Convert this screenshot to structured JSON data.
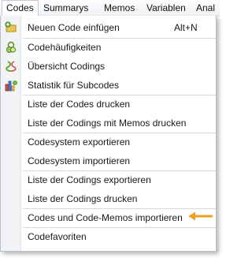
{
  "menubar": {
    "items": [
      "Codes",
      "Summarys",
      "Memos",
      "Variablen",
      "Anal"
    ]
  },
  "menu": {
    "items": [
      {
        "label": "Neuen Code einfügen",
        "shortcut": "Alt+N",
        "icon": "new-code-icon"
      },
      {
        "label": "Codehäufigkeiten",
        "icon": "code-frequencies-icon"
      },
      {
        "label": "Übersicht Codings",
        "icon": "codings-overview-icon"
      },
      {
        "label": "Statistik für Subcodes",
        "icon": "subcode-statistics-icon"
      },
      {
        "label": "Liste der Codes drucken"
      },
      {
        "label": "Liste der Codings mit Memos drucken"
      },
      {
        "label": "Codesystem exportieren"
      },
      {
        "label": "Codesystem importieren"
      },
      {
        "label": "Liste der Codings exportieren"
      },
      {
        "label": "Liste der Codings drucken"
      },
      {
        "label": "Codes und Code-Memos importieren",
        "highlight_arrow": "orange-arrow-icon"
      },
      {
        "label": "Codefavoriten"
      }
    ]
  },
  "colors": {
    "arrow": "#f0a020",
    "separator": "#d6dae0",
    "gutter": "#f1f3f5"
  }
}
